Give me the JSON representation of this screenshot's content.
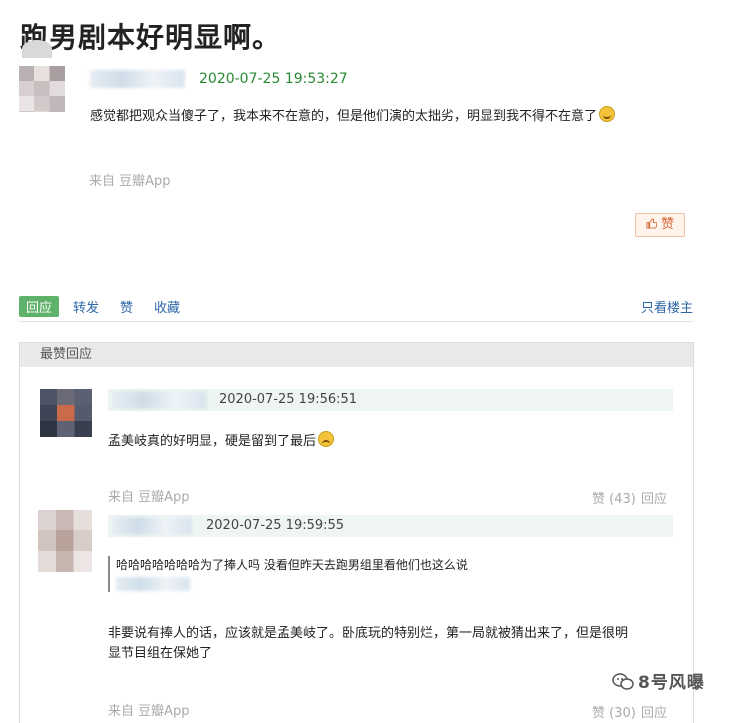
{
  "post": {
    "title": "跑男剧本好明显啊。",
    "timestamp": "2020-07-25 19:53:27",
    "content": "感觉都把观众当傻子了，我本来不在意的，但是他们演的太拙劣，明显到我不得不在意了",
    "source": "来自 豆瓣App",
    "like_label": "赞"
  },
  "actions": {
    "reply": "回应",
    "repost": "转发",
    "like": "赞",
    "collect": "收藏",
    "op_only": "只看楼主"
  },
  "best_replies": {
    "header": "最赞回应",
    "items": [
      {
        "timestamp": "2020-07-25 19:56:51",
        "content": "孟美岐真的好明显，硬是留到了最后",
        "source": "来自 豆瓣App",
        "likes": "赞 (43)",
        "reply": "回应"
      },
      {
        "timestamp": "2020-07-25 19:59:55",
        "quote": "哈哈哈哈哈哈哈为了捧人吗 没看但昨天去跑男组里看他们也这么说",
        "content_line1": "非要说有捧人的话，应该就是孟美岐了。卧底玩的特别烂，第一局就被猜出来了，但是很明",
        "content_line2": "显节目组在保她了",
        "source": "来自 豆瓣App",
        "likes": "赞 (30)",
        "reply": "回应"
      }
    ]
  },
  "watermark": "8号风曝",
  "colors": {
    "timestamp_green": "#2a8a34",
    "link_blue": "#2d67a8",
    "reply_green": "#5fb26a",
    "like_orange": "#d66a3b"
  }
}
